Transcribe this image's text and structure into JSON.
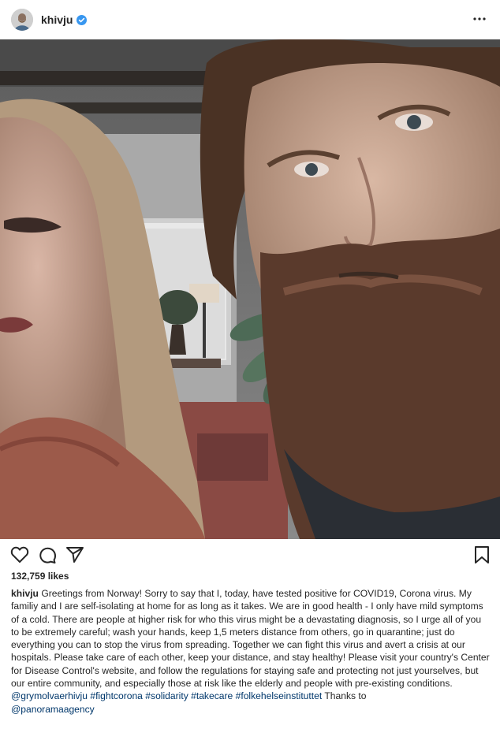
{
  "post": {
    "username": "khivju",
    "verified": true,
    "more_icon": "more-horizontal-icon",
    "avatar_icon": "avatar-icon"
  },
  "photo": {
    "icon": "photo-two-people-selfie"
  },
  "actions": {
    "like_icon": "heart-icon",
    "comment_icon": "comment-icon",
    "share_icon": "paper-plane-icon",
    "save_icon": "bookmark-icon"
  },
  "likes": {
    "count_text": "132,759 likes"
  },
  "caption": {
    "username": "khivju",
    "text": "Greetings from Norway! Sorry to say that I, today, have tested positive for COVID19, Corona virus. My familiy and I are self-isolating at home for as long as it takes. We are in good health - I only have mild symptoms of a cold. There are people at higher risk for who this virus might be a devastating diagnosis, so I urge all of you to be extremely careful; wash your hands, keep 1,5 meters distance from others, go in quarantine; just do everything you can to stop the virus from spreading. Together we can fight this virus and avert a crisis at our hospitals. Please take care of each other, keep your distance, and stay healthy! Please visit your country's Center for Disease Control's website, and follow the regulations for staying safe and protecting not just yourselves, but our entire community, and especially those at risk like the elderly and people with pre-existing conditions.",
    "mention_1": "@grymolvaerhivju",
    "hashtags": [
      "#fightcorona",
      "#solidarity",
      "#takecare",
      "#folkehelseinstituttet"
    ],
    "trailing_text": "Thanks to",
    "mention_2": "@panoramaagency"
  },
  "colors": {
    "text": "#262626",
    "link": "#00376b",
    "verified_blue": "#3897f0",
    "background": "#ffffff"
  }
}
